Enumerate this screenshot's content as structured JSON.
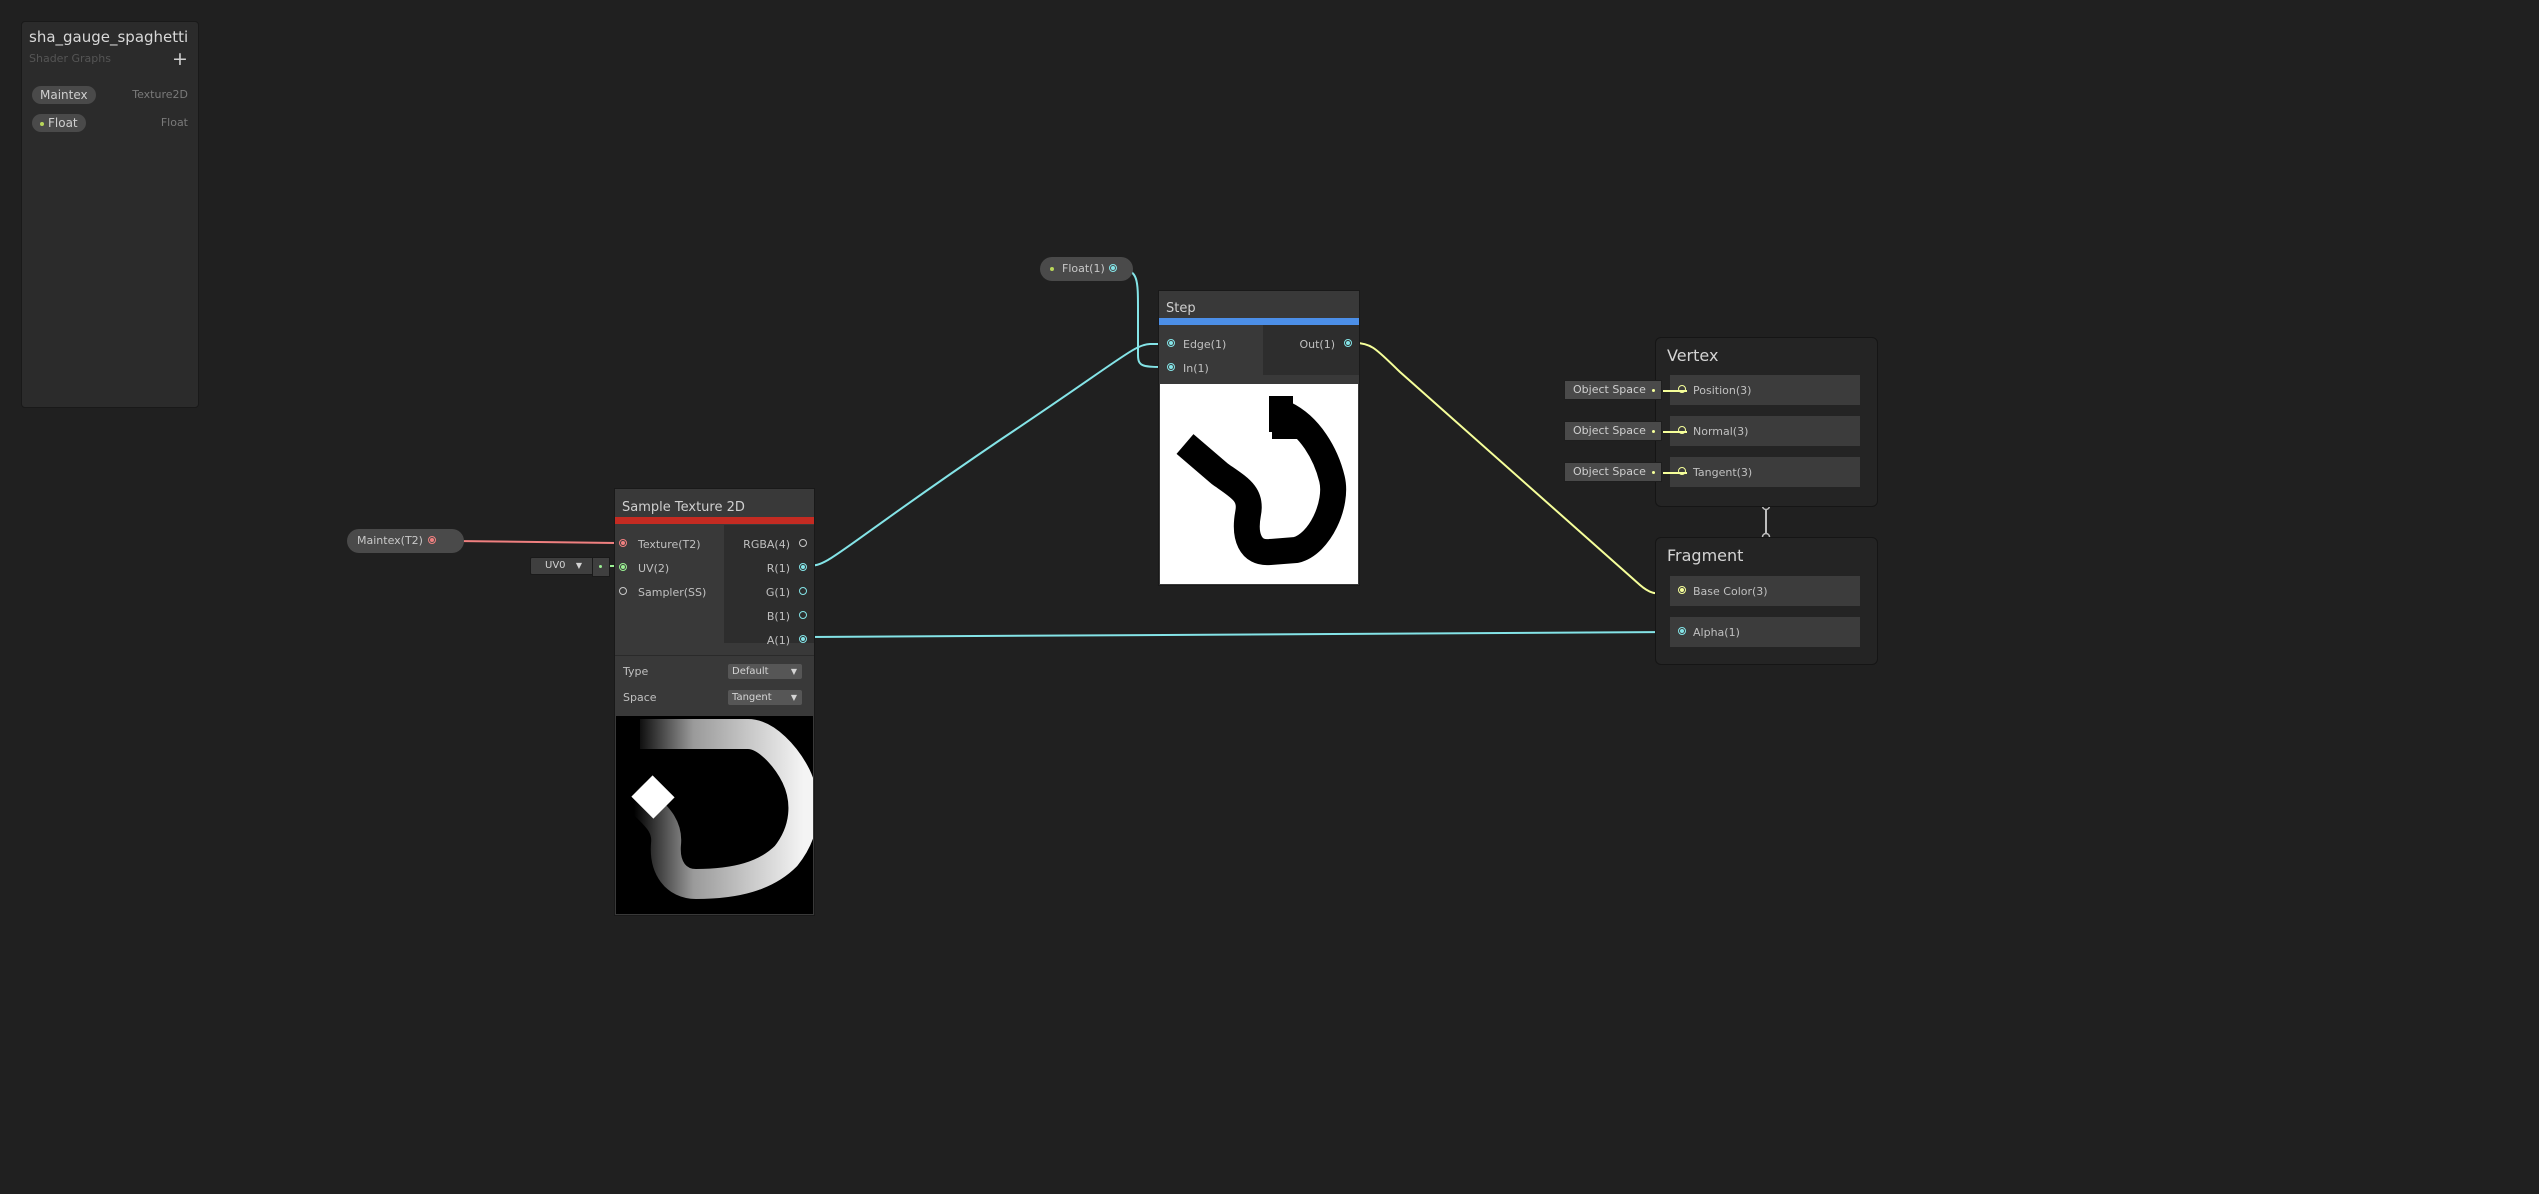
{
  "blackboard": {
    "title": "sha_gauge_spaghetti",
    "subtitle": "Shader Graphs",
    "add": "+",
    "properties": [
      {
        "name": "Maintex",
        "type": "Texture2D"
      },
      {
        "name": "Float",
        "type": "Float"
      }
    ]
  },
  "nodes": {
    "maintex_prop": {
      "label": "Maintex(T2)"
    },
    "float_prop": {
      "label": "Float(1)"
    },
    "uv_input": {
      "label": "UV0"
    },
    "sample_texture": {
      "title": "Sample Texture 2D",
      "inputs": [
        "Texture(T2)",
        "UV(2)",
        "Sampler(SS)"
      ],
      "outputs": [
        "RGBA(4)",
        "R(1)",
        "G(1)",
        "B(1)",
        "A(1)"
      ],
      "type_label": "Type",
      "type_value": "Default",
      "space_label": "Space",
      "space_value": "Tangent"
    },
    "step": {
      "title": "Step",
      "inputs": [
        "Edge(1)",
        "In(1)"
      ],
      "outputs": [
        "Out(1)"
      ]
    }
  },
  "master": {
    "vertex": {
      "title": "Vertex",
      "blocks": [
        "Position(3)",
        "Normal(3)",
        "Tangent(3)"
      ],
      "spaces": [
        "Object Space",
        "Object Space",
        "Object Space"
      ]
    },
    "fragment": {
      "title": "Fragment",
      "blocks": [
        "Base Color(3)",
        "Alpha(1)"
      ]
    }
  },
  "colors": {
    "background": "#202020",
    "texture_port": "#f08080",
    "float_port": "#84e4e7",
    "vector3_port": "#f6ff9a",
    "vector2_port": "#9aef92",
    "sample_bar": "#c42b22",
    "step_bar": "#4c8fe8"
  }
}
